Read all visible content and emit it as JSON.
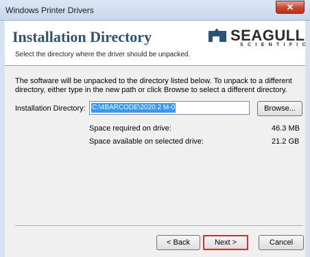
{
  "window": {
    "title": "Windows Printer Drivers",
    "close_label": "✕"
  },
  "header": {
    "title": "Installation Directory",
    "subtitle": "Select the directory where the driver should be unpacked.",
    "logo_brand": "SEAGULL",
    "logo_sub": "SCIENTIFIC"
  },
  "body": {
    "description": "The software will be unpacked to the directory listed below.  To unpack to a different directory, either type in the new path or click Browse to select a different directory.",
    "dir_label": "Installation Directory:",
    "dir_value": "C:\\4BARCODE\\2020.2 M-0",
    "browse_label": "Browse...",
    "space_required_label": "Space required on drive:",
    "space_required_value": "46.3 MB",
    "space_available_label": "Space available on selected drive:",
    "space_available_value": "21.2 GB"
  },
  "footer": {
    "back_label": "< Back",
    "next_label": "Next >",
    "cancel_label": "Cancel"
  }
}
